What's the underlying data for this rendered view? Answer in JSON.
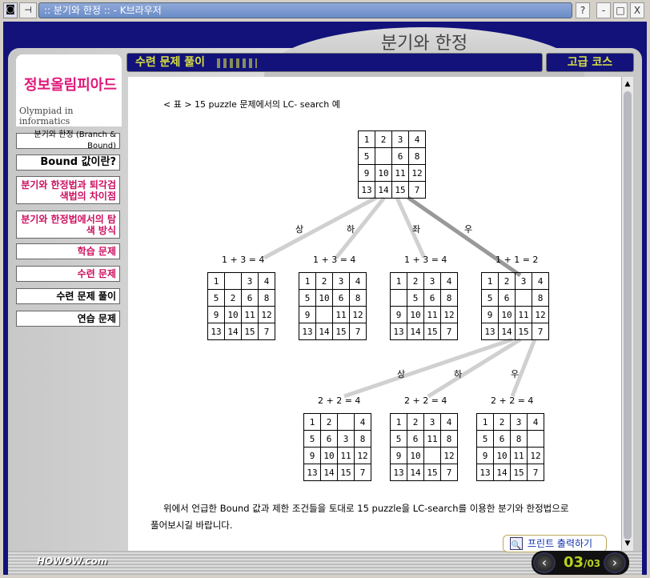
{
  "window": {
    "title": ":: 분기와 한정 :: - K브라우저",
    "help": "?",
    "minimize": "-",
    "maximize": "□",
    "close": "X",
    "pin": "⊣"
  },
  "header": {
    "arch_title": "분기와 한정",
    "section": "수련 문제 풀이",
    "course": "고급 코스"
  },
  "logo": {
    "korean": "정보올림피아드",
    "english": "Olympiad in informatics"
  },
  "sidebar": {
    "items": [
      {
        "label": "분기와 한정 (Branch & Bound)"
      },
      {
        "label": "Bound 값이란?"
      },
      {
        "label": "분기와 한정법과 퇴각검색법의 차이점"
      },
      {
        "label": "분기와 한정법에서의 탐색 방식"
      },
      {
        "label": "학습 문제"
      },
      {
        "label": "수련 문제"
      },
      {
        "label": "수련 문제 풀이"
      },
      {
        "label": "연습 문제"
      }
    ]
  },
  "content": {
    "caption": "< 표 > 15 puzzle 문제에서의 LC- search 예",
    "root": [
      [
        1,
        2,
        3,
        4
      ],
      [
        5,
        "",
        6,
        8
      ],
      [
        9,
        10,
        11,
        12
      ],
      [
        13,
        14,
        15,
        7
      ]
    ],
    "level1": [
      {
        "dir": "상",
        "cost": "1 + 3 = 4",
        "grid": [
          [
            1,
            "",
            3,
            4
          ],
          [
            5,
            2,
            6,
            8
          ],
          [
            9,
            10,
            11,
            12
          ],
          [
            13,
            14,
            15,
            7
          ]
        ]
      },
      {
        "dir": "하",
        "cost": "1 + 3 = 4",
        "grid": [
          [
            1,
            2,
            3,
            4
          ],
          [
            5,
            10,
            6,
            8
          ],
          [
            9,
            "",
            11,
            12
          ],
          [
            13,
            14,
            15,
            7
          ]
        ]
      },
      {
        "dir": "좌",
        "cost": "1 + 3 = 4",
        "grid": [
          [
            1,
            2,
            3,
            4
          ],
          [
            "",
            5,
            6,
            8
          ],
          [
            9,
            10,
            11,
            12
          ],
          [
            13,
            14,
            15,
            7
          ]
        ]
      },
      {
        "dir": "우",
        "cost": "1 + 1 = 2",
        "grid": [
          [
            1,
            2,
            3,
            4
          ],
          [
            5,
            6,
            "",
            8
          ],
          [
            9,
            10,
            11,
            12
          ],
          [
            13,
            14,
            15,
            7
          ]
        ]
      }
    ],
    "level2": [
      {
        "dir": "상",
        "cost": "2 + 2 = 4",
        "grid": [
          [
            1,
            2,
            "",
            4
          ],
          [
            5,
            6,
            3,
            8
          ],
          [
            9,
            10,
            11,
            12
          ],
          [
            13,
            14,
            15,
            7
          ]
        ]
      },
      {
        "dir": "하",
        "cost": "2 + 2 = 4",
        "grid": [
          [
            1,
            2,
            3,
            4
          ],
          [
            5,
            6,
            11,
            8
          ],
          [
            9,
            10,
            "",
            12
          ],
          [
            13,
            14,
            15,
            7
          ]
        ]
      },
      {
        "dir": "우",
        "cost": "2 + 2 = 4",
        "grid": [
          [
            1,
            2,
            3,
            4
          ],
          [
            5,
            6,
            8,
            ""
          ],
          [
            9,
            10,
            11,
            12
          ],
          [
            13,
            14,
            15,
            7
          ]
        ]
      }
    ],
    "paragraph_line1": "위에서 언급한 Bound 값과 제한 조건들을 토대로 15 puzzle을 LC-search를 이용한 분기와 한정법으로",
    "paragraph_line2": "풀어보시길 바랍니다."
  },
  "footer": {
    "brand": "HOWOW.com",
    "print_label": "프린트 출력하기",
    "page_current": "03",
    "page_total": "/03",
    "prev": "‹",
    "next": "›"
  }
}
